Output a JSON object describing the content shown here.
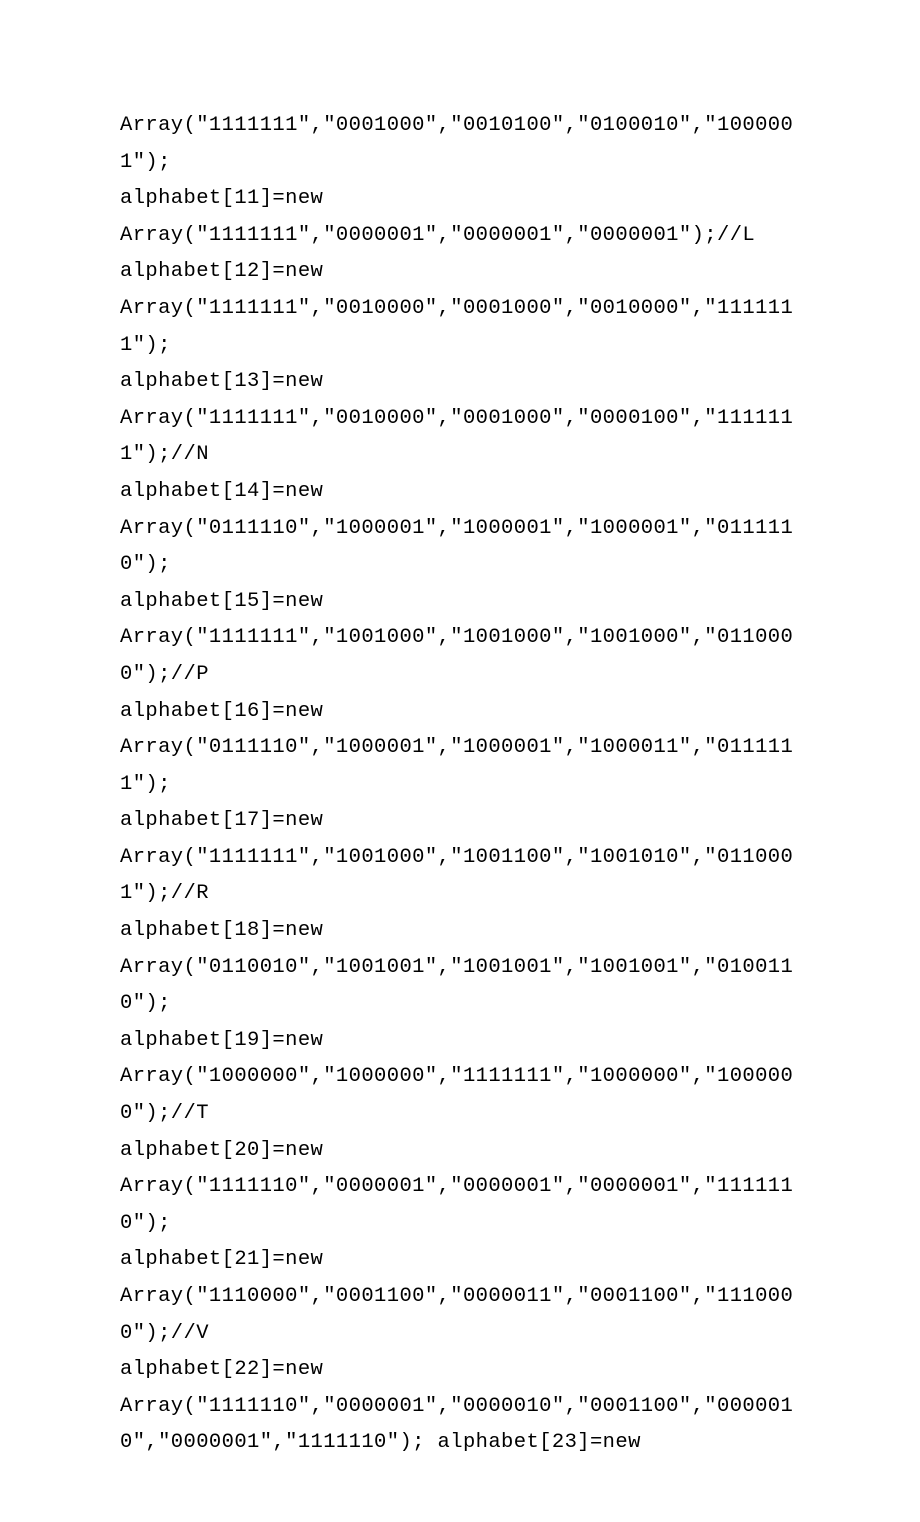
{
  "code": {
    "lines": [
      "Array(\"1111111\",\"0001000\",\"0010100\",\"0100010\",\"1000001\");",
      "alphabet[11]=new",
      "Array(\"1111111\",\"0000001\",\"0000001\",\"0000001\");//L",
      "alphabet[12]=new",
      "Array(\"1111111\",\"0010000\",\"0001000\",\"0010000\",\"1111111\");",
      "alphabet[13]=new",
      "Array(\"1111111\",\"0010000\",\"0001000\",\"0000100\",\"1111111\");//N",
      "alphabet[14]=new",
      "Array(\"0111110\",\"1000001\",\"1000001\",\"1000001\",\"0111110\");",
      "alphabet[15]=new",
      "Array(\"1111111\",\"1001000\",\"1001000\",\"1001000\",\"0110000\");//P",
      "alphabet[16]=new",
      "Array(\"0111110\",\"1000001\",\"1000001\",\"1000011\",\"0111111\");",
      "alphabet[17]=new",
      "Array(\"1111111\",\"1001000\",\"1001100\",\"1001010\",\"0110001\");//R",
      "alphabet[18]=new",
      "Array(\"0110010\",\"1001001\",\"1001001\",\"1001001\",\"0100110\");",
      "alphabet[19]=new",
      "Array(\"1000000\",\"1000000\",\"1111111\",\"1000000\",\"1000000\");//T",
      "alphabet[20]=new",
      "Array(\"1111110\",\"0000001\",\"0000001\",\"0000001\",\"1111110\");",
      "alphabet[21]=new",
      "Array(\"1110000\",\"0001100\",\"0000011\",\"0001100\",\"1110000\");//V",
      "alphabet[22]=new",
      "Array(\"1111110\",\"0000001\",\"0000010\",\"0001100\",\"0000010\",\"0000001\",\"1111110\"); alphabet[23]=new"
    ]
  }
}
